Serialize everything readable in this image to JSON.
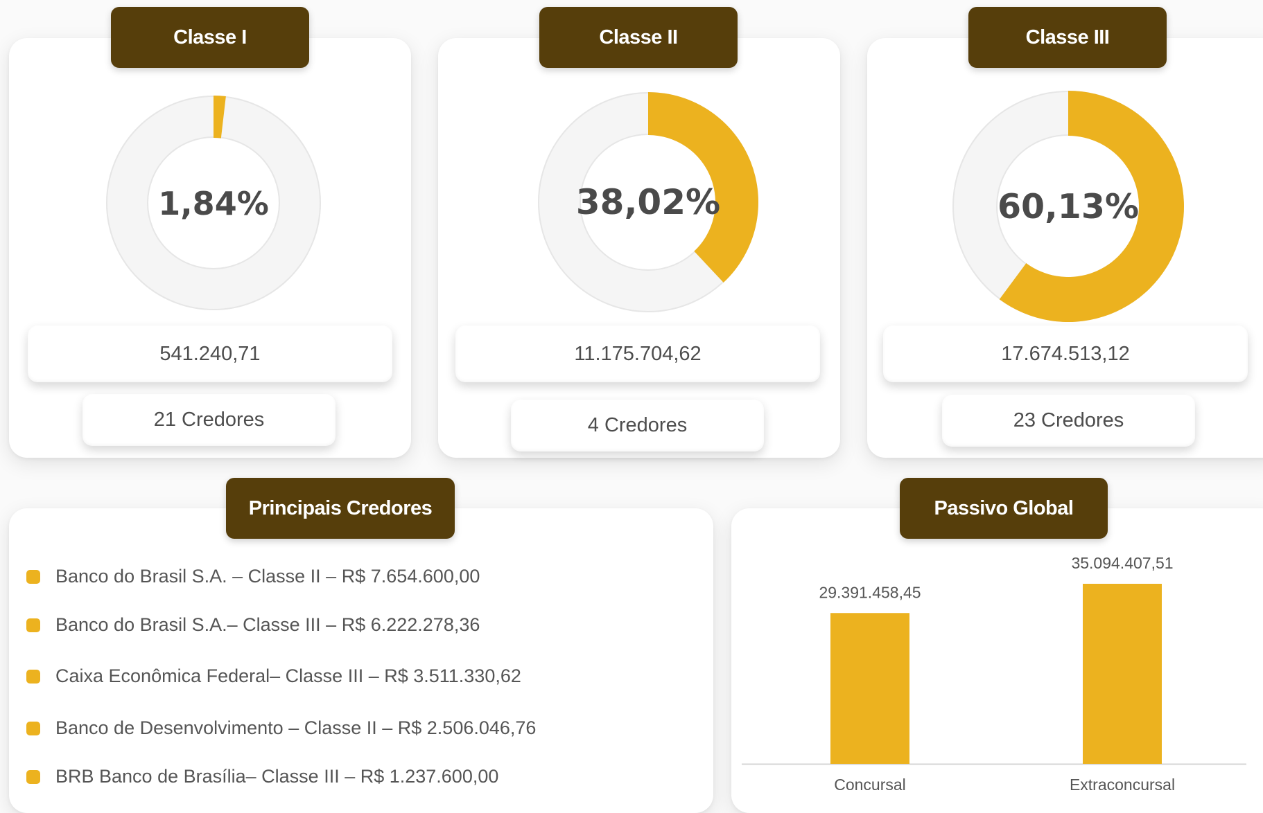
{
  "colors": {
    "accent": "#ecb21f",
    "header": "#563e0b",
    "track": "#f5f5f5"
  },
  "classes": [
    {
      "title": "Classe I",
      "percent_label": "1,84%",
      "percent": 1.84,
      "value": "541.240,71",
      "creditors": "21 Credores"
    },
    {
      "title": "Classe II",
      "percent_label": "38,02%",
      "percent": 38.02,
      "value": "11.175.704,62",
      "creditors": "4 Credores"
    },
    {
      "title": "Classe III",
      "percent_label": "60,13%",
      "percent": 60.13,
      "value": "17.674.513,12",
      "creditors": "23 Credores"
    }
  ],
  "principais": {
    "title": "Principais Credores",
    "items": [
      "Banco do Brasil  S.A. – Classe II – R$ 7.654.600,00",
      "Banco do Brasil  S.A.– Classe III – R$ 6.222.278,36",
      "Caixa Econômica Federal– Classe III – R$ 3.511.330,62",
      "Banco de Desenvolvimento – Classe II – R$ 2.506.046,76",
      "BRB Banco de Brasília– Classe III – R$ 1.237.600,00"
    ]
  },
  "passivo": {
    "title": "Passivo Global"
  },
  "chart_data": [
    {
      "type": "pie",
      "title": "Classe I",
      "values": [
        1.84,
        98.16
      ],
      "center_label": "1,84%"
    },
    {
      "type": "pie",
      "title": "Classe II",
      "values": [
        38.02,
        61.98
      ],
      "center_label": "38,02%"
    },
    {
      "type": "pie",
      "title": "Classe III",
      "values": [
        60.13,
        39.87
      ],
      "center_label": "60,13%"
    },
    {
      "type": "bar",
      "title": "Passivo Global",
      "categories": [
        "Concursal",
        "Extraconcursal"
      ],
      "values": [
        29391458.45,
        35094407.51
      ],
      "value_labels": [
        "29.391.458,45",
        "35.094.407,51"
      ],
      "ylim": [
        0,
        35094407.51
      ],
      "grid": false
    }
  ]
}
